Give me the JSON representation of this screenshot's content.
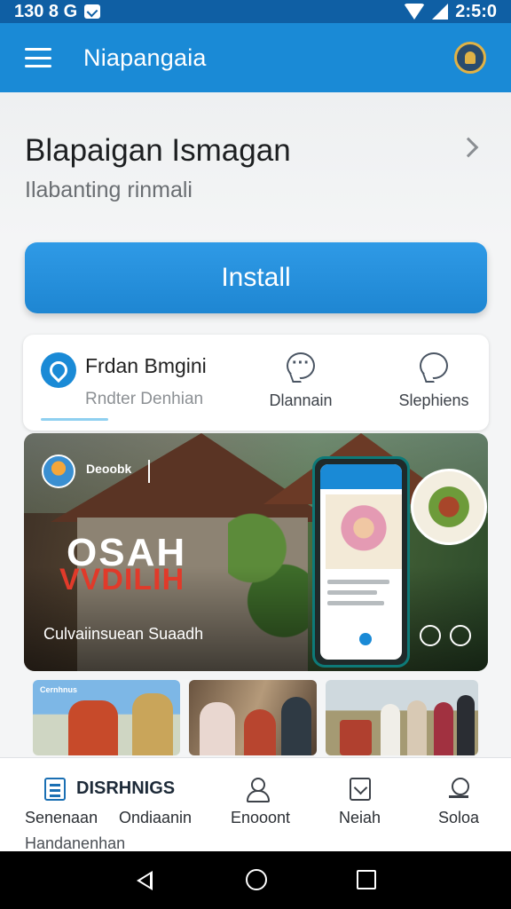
{
  "status_bar": {
    "left_text": "130 8 G",
    "time": "2:5:0"
  },
  "app_bar": {
    "title": "Niapangaia"
  },
  "headline": {
    "title": "Blapaigan Ismagan",
    "subtitle": "Ilabanting rinmali"
  },
  "install_button": {
    "label": "Install"
  },
  "tabs": {
    "main": {
      "title": "Frdan Bmgini",
      "subtitle": "Rndter Denhian"
    },
    "items": [
      {
        "label": "Dlannain",
        "icon": "chat-dots-icon"
      },
      {
        "label": "Slephiens",
        "icon": "chat-icon"
      }
    ]
  },
  "hero": {
    "brand": "Deoobk",
    "headline_top": "OSAH",
    "headline_bottom": "VVDILIH",
    "caption": "Culvaiinsuean Suaadh"
  },
  "thumbnails": {
    "first_tag": "Cernhnus"
  },
  "bottom_nav": {
    "highlight": "DISRHNIGS",
    "items": [
      {
        "label": "Senenaan",
        "icon": "list-icon"
      },
      {
        "label": "Ondiaanin",
        "icon": "none"
      },
      {
        "label": "Enooont",
        "icon": "user-icon"
      },
      {
        "label": "Neiah",
        "icon": "bookmark-icon"
      },
      {
        "label": "Soloa",
        "icon": "search-icon"
      }
    ],
    "extra_label": "Handanenhan"
  },
  "colors": {
    "app_bar": "#1a8ad6",
    "status_bar": "#0f5fa4",
    "install": "#2a94df"
  }
}
